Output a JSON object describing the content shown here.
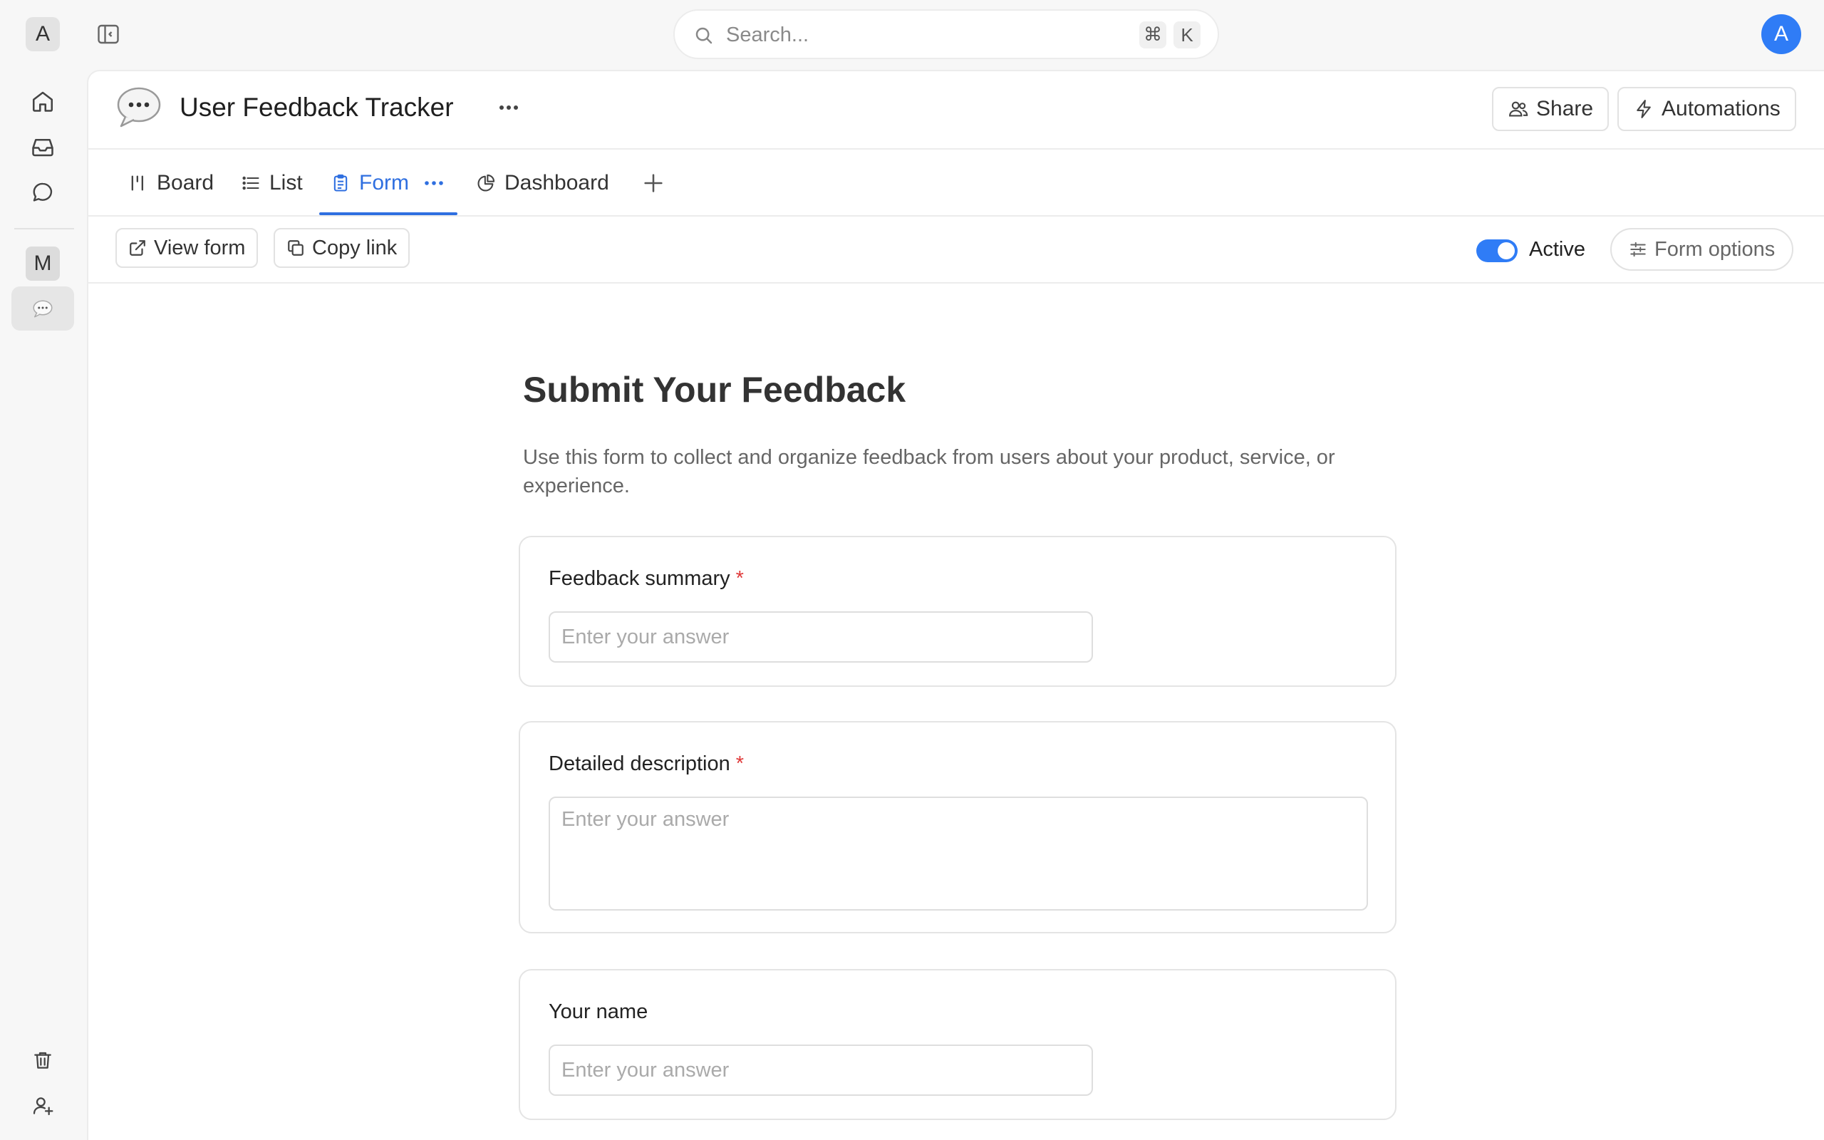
{
  "app": {
    "workspace_initial": "A",
    "search": {
      "placeholder": "Search...",
      "shortcut_symbol": "⌘",
      "shortcut_key": "K"
    },
    "user_initial": "A"
  },
  "rail": {
    "items": [
      {
        "name": "home-icon"
      },
      {
        "name": "inbox-icon"
      },
      {
        "name": "chat-icon"
      }
    ],
    "space_initial": "M",
    "bottom": [
      {
        "name": "trash-icon"
      },
      {
        "name": "invite-user-icon"
      }
    ]
  },
  "page": {
    "title": "User Feedback Tracker",
    "share_label": "Share",
    "automations_label": "Automations"
  },
  "tabs": [
    {
      "label": "Board",
      "icon": "board-icon"
    },
    {
      "label": "List",
      "icon": "list-icon"
    },
    {
      "label": "Form",
      "icon": "form-icon",
      "active": true
    },
    {
      "label": "Dashboard",
      "icon": "pie-chart-icon"
    }
  ],
  "toolbar": {
    "view_form_label": "View form",
    "copy_link_label": "Copy link",
    "active_label": "Active",
    "active_on": true,
    "form_options_label": "Form options"
  },
  "form": {
    "title": "Submit Your Feedback",
    "description": "Use this form to collect and organize feedback from users about your product, service, or experience.",
    "questions": [
      {
        "label": "Feedback summary",
        "required": true,
        "placeholder": "Enter your answer",
        "type": "short"
      },
      {
        "label": "Detailed description",
        "required": true,
        "placeholder": "Enter your answer",
        "type": "long"
      },
      {
        "label": "Your name",
        "required": false,
        "placeholder": "Enter your answer",
        "type": "short"
      }
    ],
    "required_marker": "*"
  },
  "colors": {
    "accent": "#2f6fe0",
    "toggle_on": "#2f7cf6",
    "required": "#e03b3b"
  }
}
